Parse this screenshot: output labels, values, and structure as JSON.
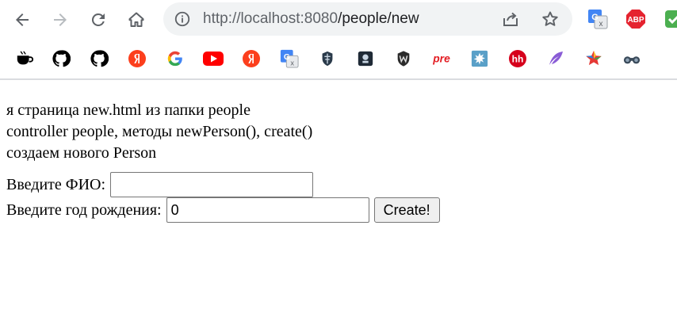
{
  "browser": {
    "url_host": "http://localhost:8080",
    "url_path": "/people/new",
    "extensions": [
      "google-translate-icon",
      "adblock-plus-icon",
      "green-extension-icon"
    ],
    "abp_label": "ABP"
  },
  "bookmarks": [
    {
      "name": "cup-icon",
      "color": "#000000"
    },
    {
      "name": "github-icon",
      "color": "#000000"
    },
    {
      "name": "github-icon",
      "color": "#000000"
    },
    {
      "name": "yandex-icon",
      "color": "#fc3f1d"
    },
    {
      "name": "google-icon",
      "color": "#4285f4"
    },
    {
      "name": "youtube-icon",
      "color": "#ff0000"
    },
    {
      "name": "yandex-icon",
      "color": "#fc3f1d"
    },
    {
      "name": "google-translate-icon",
      "color": "#4285f4"
    },
    {
      "name": "warships-icon",
      "color": "#2a3a4a"
    },
    {
      "name": "dark-app-icon",
      "color": "#1f2a36"
    },
    {
      "name": "world-of-tanks-icon",
      "color": "#2b2b2b"
    },
    {
      "name": "pre-icon",
      "color": "#e31e24",
      "label": "pre"
    },
    {
      "name": "splash-icon",
      "color": "#5aa0c8"
    },
    {
      "name": "hh-icon",
      "color": "#d6001c",
      "label": "hh"
    },
    {
      "name": "feather-icon",
      "color": "#8a5cd6"
    },
    {
      "name": "colorful-star-icon",
      "color": "#e53935"
    },
    {
      "name": "binoculars-icon",
      "color": "#3a4a5a"
    }
  ],
  "page": {
    "line1": "я страница new.html из папки people",
    "line2": "controller people, методы newPerson(), create()",
    "line3": "создаем нового Person",
    "fio_label": "Введите ФИО:",
    "fio_value": "",
    "year_label": "Введите год рождения:",
    "year_value": "0",
    "submit_label": "Create!"
  }
}
